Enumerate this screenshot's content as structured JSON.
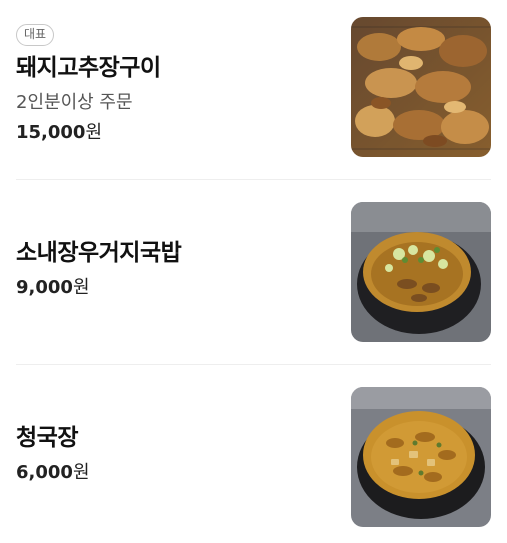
{
  "menu": {
    "items": [
      {
        "badge": "대표",
        "name": "돼지고추장구이",
        "description": "2인분이상 주문",
        "price": "15,000",
        "price_unit": "원",
        "photo": "spicy-pork-bulgogi-photo"
      },
      {
        "name": "소내장우거지국밥",
        "price": "9,000",
        "price_unit": "원",
        "photo": "beef-tripe-soup-photo"
      },
      {
        "name": "청국장",
        "price": "6,000",
        "price_unit": "원",
        "photo": "fermented-soybean-stew-photo"
      }
    ]
  }
}
